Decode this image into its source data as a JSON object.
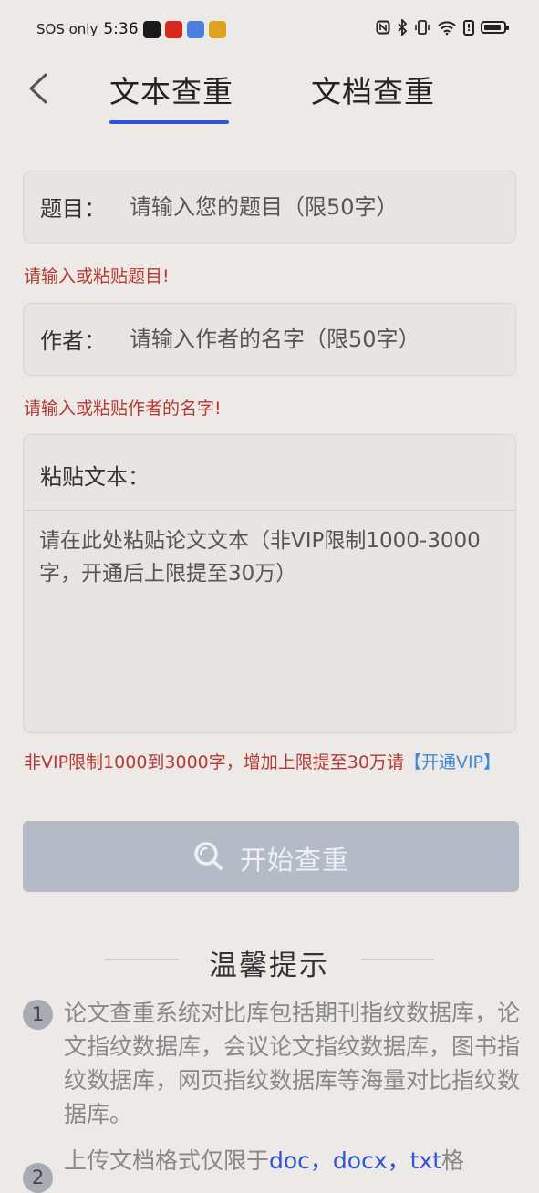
{
  "status_bar": {
    "sos": "SOS only",
    "time": "5:36",
    "app_icons": [
      "#1a1a1a",
      "#d9281f",
      "#4a7fe0",
      "#e0a020"
    ],
    "right_icons": [
      "nfc-icon",
      "bluetooth-icon",
      "vibrate-icon",
      "wifi-icon",
      "alert-icon",
      "battery-icon"
    ]
  },
  "tabs": [
    {
      "label": "文本查重",
      "active": true
    },
    {
      "label": "文档查重",
      "active": false
    }
  ],
  "form": {
    "title_label": "题目：",
    "title_placeholder": "请输入您的题目（限50字）",
    "title_error": "请输入或粘贴题目!",
    "author_label": "作者：",
    "author_placeholder": "请输入作者的名字（限50字）",
    "author_error": "请输入或粘贴作者的名字!",
    "paste_label": "粘贴文本：",
    "paste_placeholder": "请在此处粘贴论文文本（非VIP限制1000-3000字，开通后上限提至30万）",
    "vip_note": "非VIP限制1000到3000字，增加上限提至30万请",
    "vip_link": "【开通VIP】",
    "start_button": "开始查重"
  },
  "tips": {
    "title": "温馨提示",
    "items": [
      {
        "num": "1",
        "text": "论文查重系统对比库包括期刊指纹数据库，论文指纹数据库，会议论文指纹数据库，图书指纹数据库，网页指纹数据库等海量对比指纹数据库。"
      },
      {
        "num": "2",
        "text_before": "上传文档格式仅限于",
        "formats": "doc，docx，txt",
        "text_after": "格"
      }
    ]
  },
  "colors": {
    "accent": "#2f55d4",
    "error": "#b53a33",
    "link": "#3a8ad8",
    "button_disabled": "#b4bac6",
    "background": "#ece9e6"
  }
}
